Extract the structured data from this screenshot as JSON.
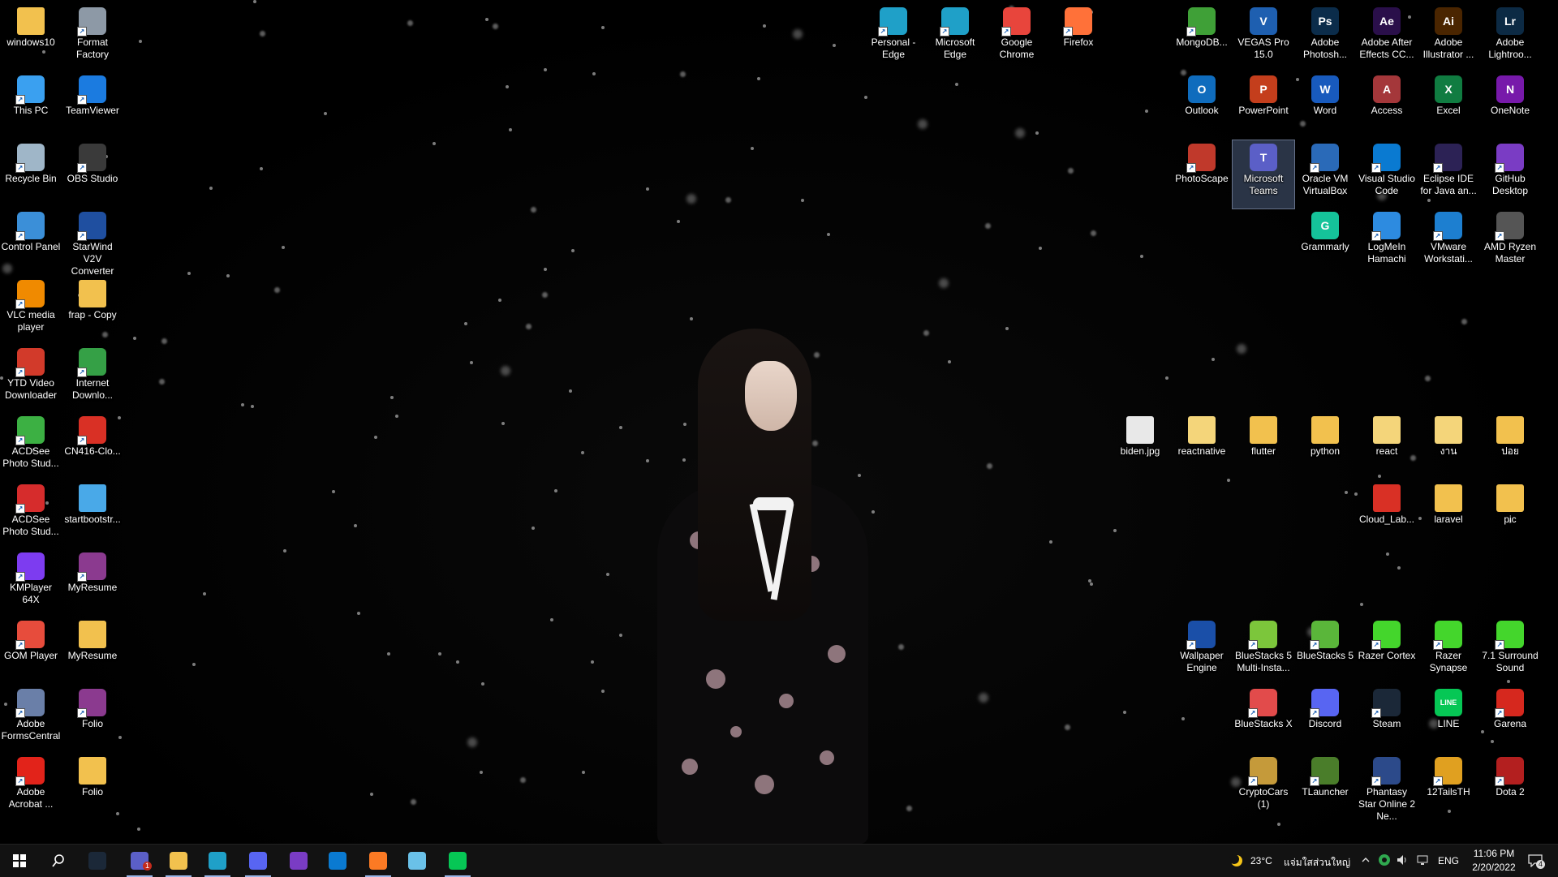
{
  "desktop": {
    "left_col1": [
      {
        "label": "windows10",
        "icon": "folder-user-icon",
        "color": "#f2c14e",
        "kind": "folder"
      },
      {
        "label": "This PC",
        "icon": "computer-icon",
        "color": "#3aa0f0"
      },
      {
        "label": "Recycle Bin",
        "icon": "recycle-bin-icon",
        "color": "#9fb6c8"
      },
      {
        "label": "Control Panel",
        "icon": "control-panel-icon",
        "color": "#3b8fd8"
      },
      {
        "label": "VLC media player",
        "icon": "vlc-icon",
        "color": "#f08a00"
      },
      {
        "label": "YTD Video Downloader",
        "icon": "ytd-icon",
        "color": "#d23a2a"
      },
      {
        "label": "ACDSee Photo Stud...",
        "icon": "acdsee-icon",
        "color": "#3cb043"
      },
      {
        "label": "ACDSee Photo Stud...",
        "icon": "acdsee-red-icon",
        "color": "#d62c2c"
      },
      {
        "label": "KMPlayer 64X",
        "icon": "kmplayer-icon",
        "color": "#7d3cf0"
      },
      {
        "label": "GOM Player",
        "icon": "gom-player-icon",
        "color": "#e74c3c"
      },
      {
        "label": "Adobe FormsCentral",
        "icon": "adobe-formscentral-icon",
        "color": "#6a7fa8"
      },
      {
        "label": "Adobe Acrobat ...",
        "icon": "adobe-acrobat-icon",
        "color": "#e2231a"
      }
    ],
    "left_col2": [
      {
        "label": "Format Factory",
        "icon": "format-factory-icon",
        "color": "#8d99a6"
      },
      {
        "label": "TeamViewer",
        "icon": "teamviewer-icon",
        "color": "#1b7be0"
      },
      {
        "label": "OBS Studio",
        "icon": "obs-icon",
        "color": "#3a3a3a"
      },
      {
        "label": "StarWind V2V Converter",
        "icon": "starwind-icon",
        "color": "#1f4fa0"
      },
      {
        "label": "frap - Copy",
        "icon": "folder-icon",
        "color": "#f2c14e",
        "kind": "folder"
      },
      {
        "label": "Internet Downlo...",
        "icon": "idm-icon",
        "color": "#35a046"
      },
      {
        "label": "CN416-Clo...",
        "icon": "pdf-icon",
        "color": "#d93025"
      },
      {
        "label": "startbootstr...",
        "icon": "folder-icon",
        "color": "#49a9e8",
        "kind": "folder"
      },
      {
        "label": "MyResume",
        "icon": "winrar-icon",
        "color": "#8b3a8f"
      },
      {
        "label": "MyResume",
        "icon": "folder-icon",
        "color": "#f2c14e",
        "kind": "folder"
      },
      {
        "label": "Folio",
        "icon": "winrar-icon",
        "color": "#8b3a8f"
      },
      {
        "label": "Folio",
        "icon": "folder-icon",
        "color": "#f2c14e",
        "kind": "folder"
      }
    ],
    "top_middle": [
      {
        "label": "Personal - Edge",
        "icon": "edge-icon",
        "color": "#1fa0c8"
      },
      {
        "label": "Microsoft Edge",
        "icon": "edge-icon",
        "color": "#1fa0c8"
      },
      {
        "label": "Google Chrome",
        "icon": "chrome-icon",
        "color": "#e8453c"
      },
      {
        "label": "Firefox",
        "icon": "firefox-icon",
        "color": "#ff7139"
      }
    ],
    "right_row1": [
      {
        "label": "MongoDB...",
        "icon": "mongodb-icon",
        "color": "#3fa037"
      },
      {
        "label": "VEGAS Pro 15.0",
        "icon": "vegas-icon",
        "color": "#1e5fb0",
        "text": "V"
      },
      {
        "label": "Adobe Photosh...",
        "icon": "photoshop-icon",
        "color": "#0b2c4a",
        "text": "Ps"
      },
      {
        "label": "Adobe After Effects CC...",
        "icon": "after-effects-icon",
        "color": "#2a0f4a",
        "text": "Ae"
      },
      {
        "label": "Adobe Illustrator ...",
        "icon": "illustrator-icon",
        "color": "#4a2500",
        "text": "Ai"
      },
      {
        "label": "Adobe Lightroo...",
        "icon": "lightroom-icon",
        "color": "#0c2a44",
        "text": "Lr"
      }
    ],
    "right_row2": [
      {
        "label": "Outlook",
        "icon": "outlook-icon",
        "color": "#0f6cbd",
        "text": "O"
      },
      {
        "label": "PowerPoint",
        "icon": "powerpoint-icon",
        "color": "#c43e1c",
        "text": "P"
      },
      {
        "label": "Word",
        "icon": "word-icon",
        "color": "#185abd",
        "text": "W"
      },
      {
        "label": "Access",
        "icon": "access-icon",
        "color": "#a4373a",
        "text": "A"
      },
      {
        "label": "Excel",
        "icon": "excel-icon",
        "color": "#107c41",
        "text": "X"
      },
      {
        "label": "OneNote",
        "icon": "onenote-icon",
        "color": "#7719aa",
        "text": "N"
      }
    ],
    "right_row3": [
      {
        "label": "PhotoScape",
        "icon": "photoscape-icon",
        "color": "#c0392b"
      },
      {
        "label": "Microsoft Teams",
        "icon": "teams-icon",
        "color": "#5b5fc7",
        "text": "T",
        "selected": true
      },
      {
        "label": "Oracle VM VirtualBox",
        "icon": "virtualbox-icon",
        "color": "#2a6ab8"
      },
      {
        "label": "Visual Studio Code",
        "icon": "vscode-icon",
        "color": "#0a7ad1"
      },
      {
        "label": "Eclipse IDE for Java an...",
        "icon": "eclipse-icon",
        "color": "#2c2255"
      },
      {
        "label": "GitHub Desktop",
        "icon": "github-desktop-icon",
        "color": "#7a3cc4"
      }
    ],
    "right_row4": [
      {
        "label": "Grammarly",
        "icon": "grammarly-icon",
        "color": "#15c39a",
        "text": "G"
      },
      {
        "label": "LogMeIn Hamachi",
        "icon": "hamachi-icon",
        "color": "#2d8be0"
      },
      {
        "label": "VMware Workstati...",
        "icon": "vmware-icon",
        "color": "#1d7fd0"
      },
      {
        "label": "AMD Ryzen Master",
        "icon": "ryzen-master-icon",
        "color": "#555555"
      }
    ],
    "files_row1": [
      {
        "label": "biden.jpg",
        "icon": "image-file-icon",
        "color": "#e8e8e8",
        "kind": "folder"
      },
      {
        "label": "reactnative",
        "icon": "folder-icon",
        "color": "#f4d57a",
        "kind": "folder"
      },
      {
        "label": "flutter",
        "icon": "folder-icon",
        "color": "#f2c14e",
        "kind": "folder"
      },
      {
        "label": "python",
        "icon": "folder-icon",
        "color": "#f2c14e",
        "kind": "folder"
      },
      {
        "label": "react",
        "icon": "folder-icon",
        "color": "#f4d57a",
        "kind": "folder"
      },
      {
        "label": "งาน",
        "icon": "folder-icon",
        "color": "#f4d57a",
        "kind": "folder"
      },
      {
        "label": "ปอย",
        "icon": "folder-icon",
        "color": "#f2c14e",
        "kind": "folder"
      }
    ],
    "files_row2": [
      {
        "label": "Cloud_Lab...",
        "icon": "pdf-icon",
        "color": "#d93025",
        "kind": "folder"
      },
      {
        "label": "laravel",
        "icon": "folder-icon",
        "color": "#f2c14e",
        "kind": "folder"
      },
      {
        "label": "pic",
        "icon": "folder-icon",
        "color": "#f2c14e",
        "kind": "folder"
      }
    ],
    "games_row1": [
      {
        "label": "Wallpaper Engine",
        "icon": "wallpaper-engine-icon",
        "color": "#1a4fa8"
      },
      {
        "label": "BlueStacks 5 Multi-Insta...",
        "icon": "bluestacks-multi-icon",
        "color": "#7cc63b"
      },
      {
        "label": "BlueStacks 5",
        "icon": "bluestacks-icon",
        "color": "#5ab63a"
      },
      {
        "label": "Razer Cortex",
        "icon": "razer-cortex-icon",
        "color": "#44d62c"
      },
      {
        "label": "Razer Synapse",
        "icon": "razer-synapse-icon",
        "color": "#44d62c"
      },
      {
        "label": "7.1 Surround Sound",
        "icon": "surround-sound-icon",
        "color": "#44d62c"
      }
    ],
    "games_row2": [
      {
        "label": "BlueStacks X",
        "icon": "bluestacks-x-icon",
        "color": "#e24b4b"
      },
      {
        "label": "Discord",
        "icon": "discord-icon",
        "color": "#5865f2"
      },
      {
        "label": "Steam",
        "icon": "steam-icon",
        "color": "#1b2838"
      },
      {
        "label": "LINE",
        "icon": "line-icon",
        "color": "#06c755",
        "text": "LINE"
      },
      {
        "label": "Garena",
        "icon": "garena-icon",
        "color": "#d6281e"
      }
    ],
    "games_row3": [
      {
        "label": "CryptoCars (1)",
        "icon": "cryptocars-icon",
        "color": "#c59a3a"
      },
      {
        "label": "TLauncher",
        "icon": "tlauncher-icon",
        "color": "#4a7d2a"
      },
      {
        "label": "Phantasy Star Online 2 Ne...",
        "icon": "pso2-icon",
        "color": "#2c4a8a"
      },
      {
        "label": "12TailsTH",
        "icon": "12tails-icon",
        "color": "#e0a020"
      },
      {
        "label": "Dota 2",
        "icon": "dota2-icon",
        "color": "#b31f1f"
      }
    ]
  },
  "taskbar": {
    "apps": [
      {
        "name": "start-button",
        "icon": "windows-logo-icon",
        "color": "#ffffff"
      },
      {
        "name": "search-button",
        "icon": "search-icon",
        "color": "#ffffff"
      },
      {
        "name": "taskbar-steam",
        "icon": "steam-icon",
        "color": "#1b2838"
      },
      {
        "name": "taskbar-teams",
        "icon": "teams-icon",
        "color": "#5b5fc7",
        "badge": "1"
      },
      {
        "name": "taskbar-file-explorer",
        "icon": "folder-icon",
        "color": "#f2c14e"
      },
      {
        "name": "taskbar-edge",
        "icon": "edge-icon",
        "color": "#1fa0c8"
      },
      {
        "name": "taskbar-discord",
        "icon": "discord-icon",
        "color": "#5865f2"
      },
      {
        "name": "taskbar-github-desktop",
        "icon": "github-desktop-icon",
        "color": "#7a3cc4"
      },
      {
        "name": "taskbar-vscode",
        "icon": "vscode-icon",
        "color": "#0a7ad1"
      },
      {
        "name": "taskbar-xampp",
        "icon": "xampp-icon",
        "color": "#fb7a24"
      },
      {
        "name": "taskbar-notepad",
        "icon": "notepad-icon",
        "color": "#6ac1e8"
      },
      {
        "name": "taskbar-line",
        "icon": "line-icon",
        "color": "#06c755"
      }
    ],
    "weather": {
      "temp": "23°C",
      "location": "แจ่มใสส่วนใหญ่"
    },
    "language": "ENG",
    "time": "11:06 PM",
    "date": "2/20/2022",
    "notifications": "4"
  }
}
